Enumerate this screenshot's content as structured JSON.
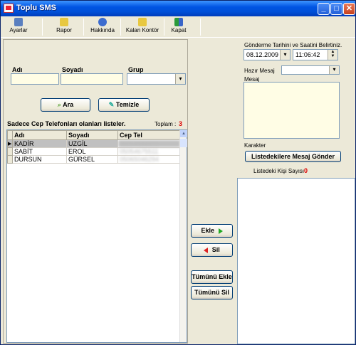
{
  "window": {
    "title": "Toplu SMS",
    "min": "_",
    "max": "□",
    "close": "✕"
  },
  "toolbar": {
    "items": [
      {
        "label": "Ayarlar",
        "icon": "settings-icon"
      },
      {
        "label": "Rapor",
        "icon": "report-icon"
      },
      {
        "label": "Hakkında",
        "icon": "help-icon"
      },
      {
        "label": "Kalan Kontör",
        "icon": "credit-icon"
      },
      {
        "label": "Kapat",
        "icon": "exit-icon"
      }
    ]
  },
  "filters": {
    "name_label": "Adı",
    "surname_label": "Soyadı",
    "group_label": "Grup"
  },
  "buttons": {
    "search": "Ara",
    "clear": "Temizle",
    "add": "Ekle",
    "delete": "Sil",
    "add_all": "Tümünü Ekle",
    "delete_all": "Tümünü Sil",
    "send": "Listedekilere Mesaj Gönder"
  },
  "grid": {
    "caption": "Sadece Cep Telefonları olanları listeler.",
    "total_label": "Toplam :",
    "total_value": "3",
    "columns": [
      "Adı",
      "Soyadı",
      "Cep Tel"
    ],
    "rows": [
      {
        "name": "KADİR",
        "surname": "UZGİL",
        "phone": "05054644470"
      },
      {
        "name": "SABİT",
        "surname": "EROL",
        "phone": "05054675511"
      },
      {
        "name": "DURSUN",
        "surname": "GÜRSEL",
        "phone": "05065046294"
      }
    ]
  },
  "send_panel": {
    "schedule_label": "Gönderme Tarihini ve Saatini Belirtiniz.",
    "date_value": "08.12.2009",
    "time_value": "11:06:42",
    "ready_msg_label": "Hazır Mesaj",
    "message_label": "Mesaj",
    "char_label": "Karakter",
    "count_label": "Listedeki Kişi Sayısı",
    "count_value": "0"
  }
}
